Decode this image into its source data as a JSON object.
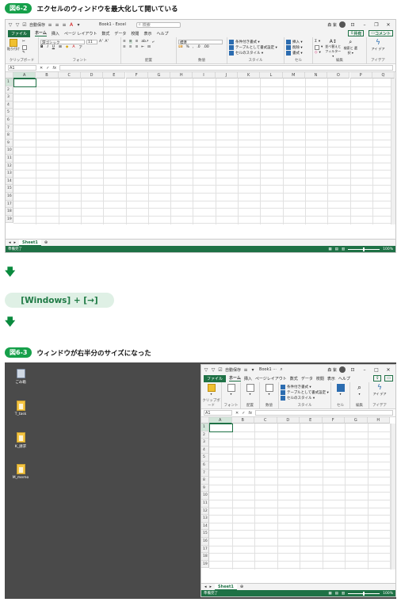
{
  "fig1": {
    "badge": "図6-2",
    "caption": "エクセルのウィンドウを最大化して開いている"
  },
  "fig2": {
    "badge": "図6-3",
    "caption": "ウィンドウが右半分のサイズになった"
  },
  "shortcut": "[Windows] + [→]",
  "excel": {
    "title": "Book1 - Excel",
    "title_short": "Book1 ···",
    "autosave": "自動保存",
    "search_placeholder": "検索",
    "user": "森 紫",
    "menu": [
      "ファイル",
      "ホーム",
      "挿入",
      "ページ レイアウト",
      "数式",
      "データ",
      "校閲",
      "表示",
      "ヘルプ"
    ],
    "menu_short": [
      "ファイル",
      "ホーム",
      "挿入",
      "ページレイアウト",
      "数式",
      "データ",
      "校閲",
      "表示",
      "ヘルプ"
    ],
    "share": "共有",
    "comment": "コメント",
    "font_name": "游ゴシック",
    "font_size": "11",
    "number_format": "標準",
    "groups": {
      "clipboard": "クリップボード",
      "paste": "貼り付け",
      "font": "フォント",
      "alignment": "配置",
      "number": "数値",
      "styles": "スタイル",
      "cells": "セル",
      "editing": "編集",
      "ideas": "アイデア"
    },
    "styles_items": [
      "条件付き書式 ▾",
      "テーブルとして書式設定 ▾",
      "セルのスタイル ▾"
    ],
    "cells_items": [
      "挿入 ▾",
      "削除 ▾",
      "書式 ▾"
    ],
    "editing_items": [
      "並べ替えと フィルター ▾",
      "検索と 選択 ▾"
    ],
    "ideas_label": "アイ デア",
    "name_box": "A1",
    "fx": "fx",
    "columns_full": [
      "A",
      "B",
      "C",
      "D",
      "E",
      "F",
      "G",
      "H",
      "I",
      "J",
      "K",
      "L",
      "M",
      "N",
      "O",
      "P",
      "Q"
    ],
    "columns_half": [
      "A",
      "B",
      "C",
      "D",
      "E",
      "F",
      "G",
      "H"
    ],
    "rows": [
      "1",
      "2",
      "3",
      "4",
      "5",
      "6",
      "7",
      "8",
      "9",
      "10",
      "11",
      "12",
      "13",
      "14",
      "15",
      "16",
      "17",
      "18",
      "19"
    ],
    "sheet": "Sheet1",
    "status": "準備完了",
    "zoom": "100%"
  },
  "desktop": {
    "icons": [
      "ごみ箱",
      "T_task",
      "K_請求",
      "M_memo"
    ]
  }
}
